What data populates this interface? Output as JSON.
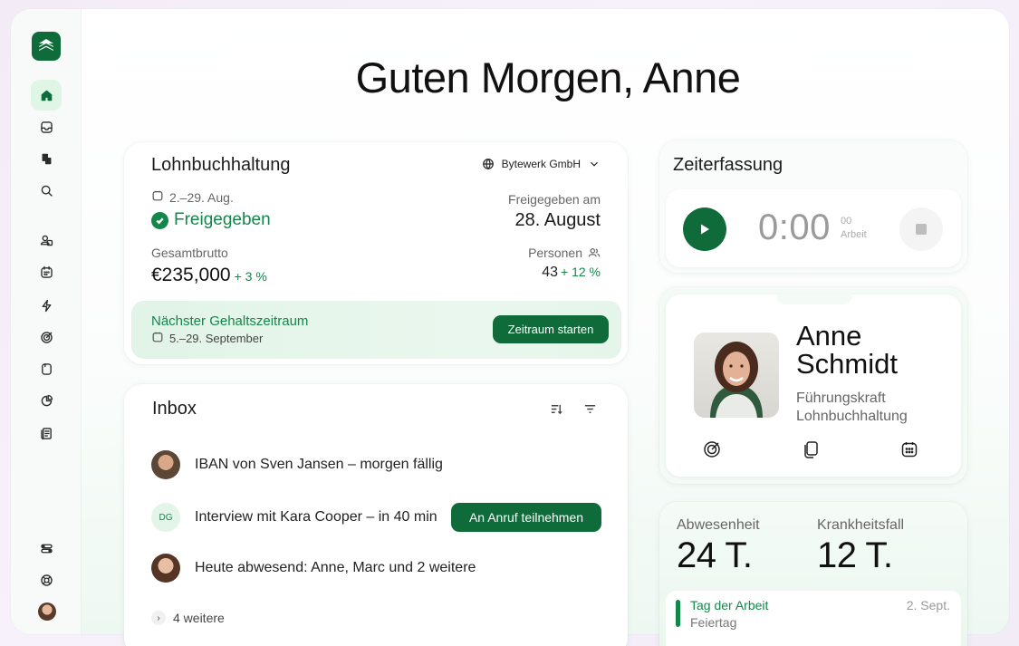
{
  "greeting": "Guten Morgen, Anne",
  "payroll": {
    "title": "Lohnbuchhaltung",
    "company": "Bytewerk GmbH",
    "date_range": "2.–29. Aug.",
    "status": "Freigegeben",
    "approved_label": "Freigegeben am",
    "approved_value": "28. August",
    "gross_label": "Gesamtbrutto",
    "gross_value": "€235,000",
    "gross_delta": "+ 3 %",
    "persons_label": "Personen",
    "persons_value": "43",
    "persons_delta": "+ 12 %",
    "next_title": "Nächster Gehaltszeitraum",
    "next_date": "5.–29. September",
    "next_button": "Zeitraum starten"
  },
  "inbox": {
    "title": "Inbox",
    "messages": [
      {
        "text": "IBAN von Sven Jansen – morgen fällig",
        "avatar": "photo"
      },
      {
        "text": "Interview mit Kara Cooper – in 40 min",
        "avatar": "DG",
        "action": "An Anruf teilnehmen"
      },
      {
        "text": "Heute abwesend: Anne, Marc und 2 weitere",
        "avatar": "photo"
      }
    ],
    "more": "4 weitere"
  },
  "time_tracking": {
    "title": "Zeiterfassung",
    "clock": "0:00",
    "seconds": "00",
    "mode": "Arbeit"
  },
  "profile": {
    "first_name": "Anne",
    "last_name": "Schmidt",
    "role_line1": "Führungskraft",
    "role_line2": "Lohnbuchhaltung"
  },
  "absence": {
    "absence_label": "Abwesenheit",
    "absence_value": "24 T.",
    "sick_label": "Krankheitsfall",
    "sick_value": "12 T.",
    "holiday_title": "Tag der Arbeit",
    "holiday_sub": "Feiertag",
    "holiday_date": "2. Sept."
  },
  "colors": {
    "brand": "#0f6b3a",
    "accent": "#13874a",
    "accent_bg": "#e1f4e7"
  },
  "icons": {
    "sidebar": [
      "logo-icon",
      "home-icon",
      "inbox-icon",
      "integrations-icon",
      "search-icon",
      "people-icon",
      "calendar-icon",
      "bolt-icon",
      "target-icon",
      "document-icon",
      "pie-chart-icon",
      "ledger-icon",
      "toggles-icon",
      "help-icon"
    ]
  }
}
